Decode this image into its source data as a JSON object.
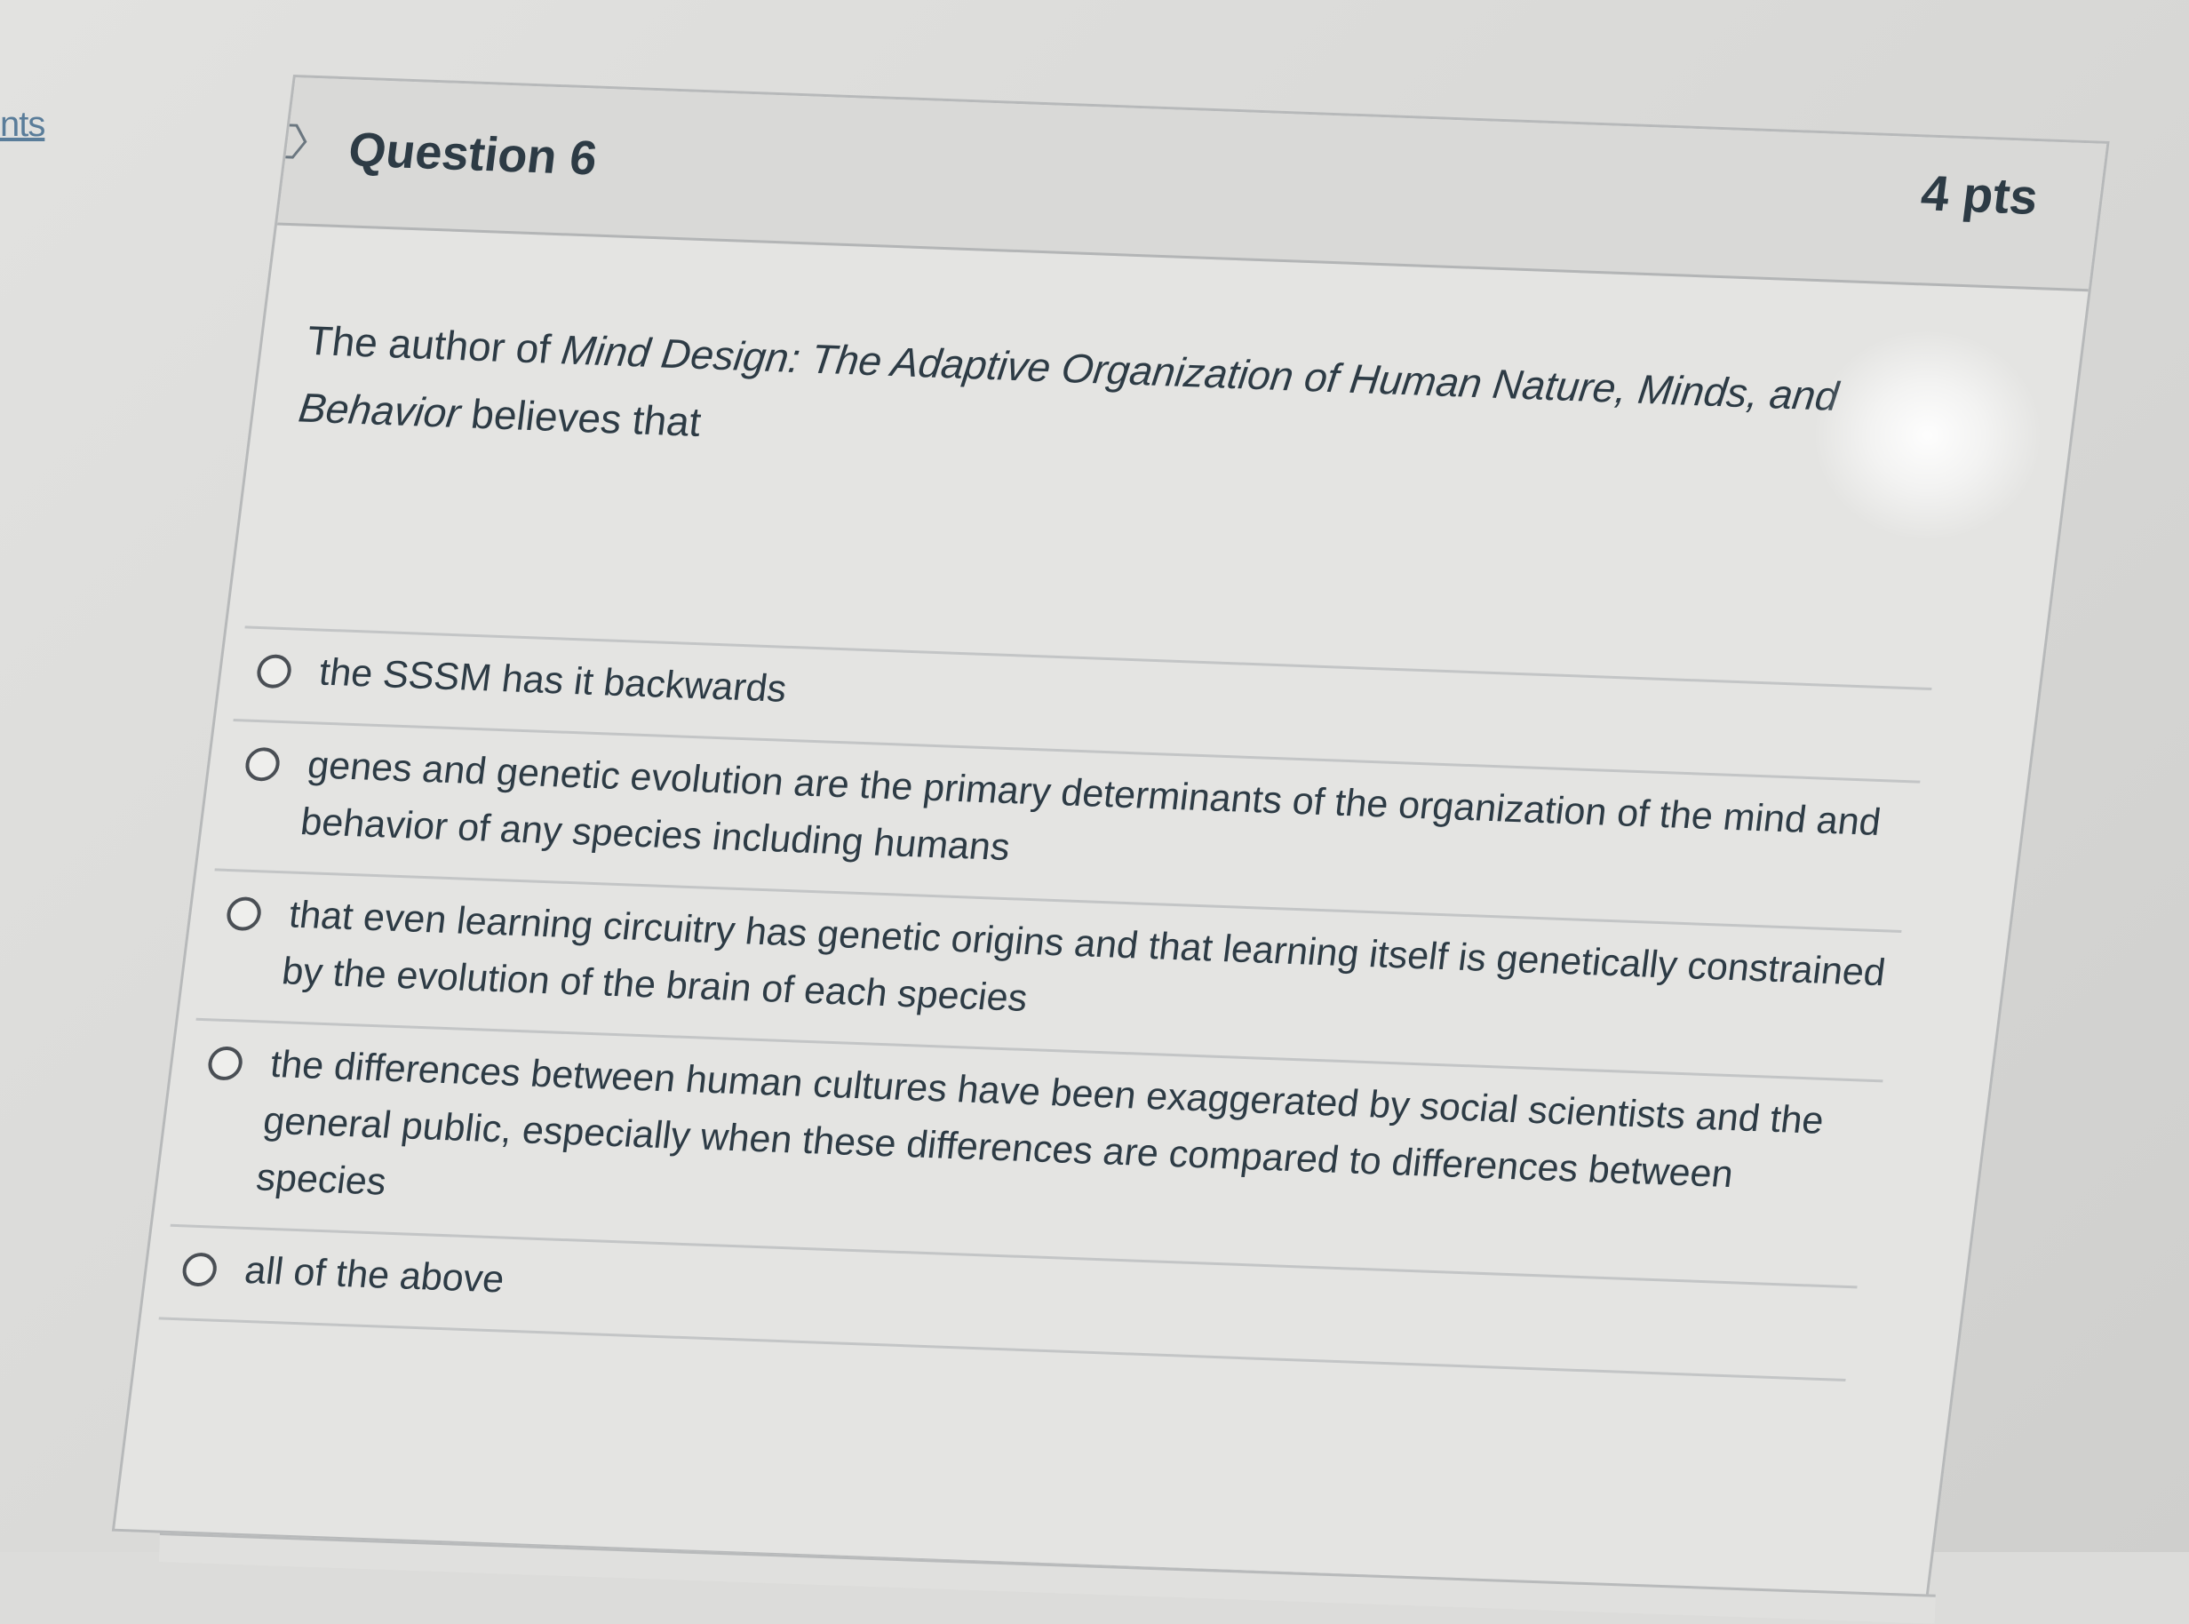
{
  "sidebar": {
    "link_fragment": "nts"
  },
  "question": {
    "title": "Question 6",
    "points": "4 pts",
    "flag_icon": "flag-icon",
    "stem_before": "The author of ",
    "stem_italic": "Mind Design: The Adaptive Organization of Human Nature, Minds, and Behavior",
    "stem_after": " believes that"
  },
  "answers": [
    {
      "label": "the SSSM has it backwards"
    },
    {
      "label": "genes and genetic evolution are the primary determinants of the organization of the mind and behavior of any species including humans"
    },
    {
      "label": "that even learning circuitry has genetic origins and that learning itself is genetically constrained by the evolution of the brain of each species"
    },
    {
      "label": "the differences between human cultures have been exaggerated by social scientists and the general public, especially when these differences are compared to differences between species"
    },
    {
      "label": "all of the above"
    }
  ]
}
